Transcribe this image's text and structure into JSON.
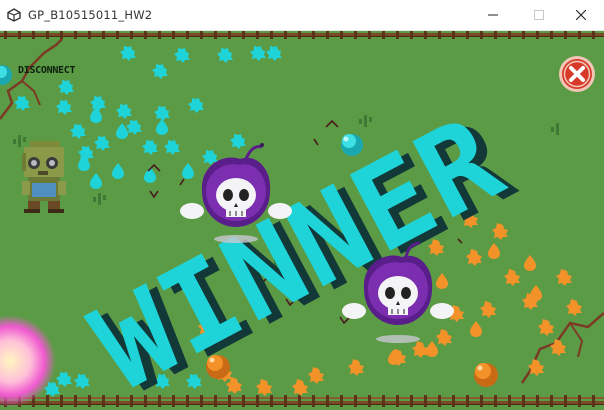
{
  "window": {
    "title": "GP_B10515011_HW2",
    "minimize_icon": "minimize-icon",
    "maximize_icon": "maximize-icon",
    "close_icon": "close-icon"
  },
  "hud": {
    "disconnect_label": "DISCONNECT",
    "exit_icon": "close-icon",
    "colors": {
      "accent_red": "#d83a2a",
      "cyan": "#1ed4d8",
      "orange": "#f4922a",
      "purple": "#7b2fb0",
      "grass": "#5c9b46"
    }
  },
  "banner": {
    "text": "WINNER"
  }
}
